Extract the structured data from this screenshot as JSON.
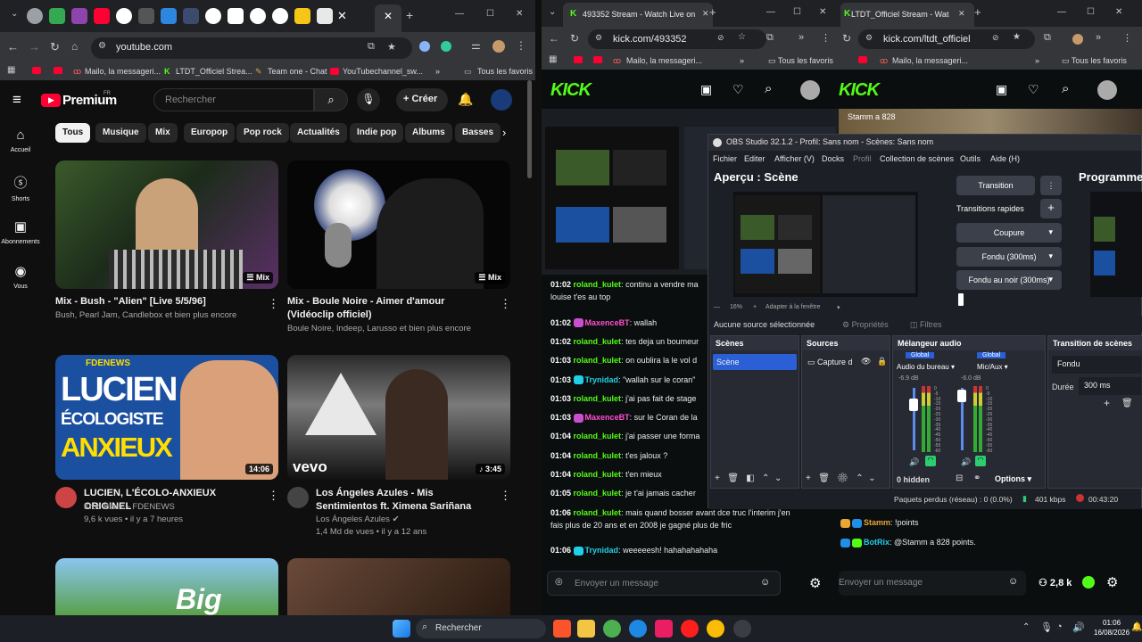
{
  "youtube": {
    "tabs": {
      "new_tab": "+",
      "minimize": "—",
      "maximize": "☐",
      "close": "✕"
    },
    "url": "youtube.com",
    "bookmarks": [
      "Mailo, la messageri...",
      "LTDT_Officiel Strea...",
      "Team one - Chat",
      "YouTubechannel_sw...",
      "Tous les favoris"
    ],
    "logo": "Premium",
    "logo_region": "FR",
    "search_placeholder": "Rechercher",
    "create_label": "Créer",
    "nav": [
      {
        "label": "Accueil",
        "icon": "home-icon"
      },
      {
        "label": "Shorts",
        "icon": "shorts-icon"
      },
      {
        "label": "Abonnements",
        "icon": "subscriptions-icon"
      },
      {
        "label": "Vous",
        "icon": "user-icon"
      }
    ],
    "chips": [
      "Tous",
      "Musique",
      "Mix",
      "Europop",
      "Pop rock",
      "Actualités",
      "Indie pop",
      "Albums",
      "Basses"
    ],
    "videos": [
      {
        "title": "Mix - Bush - \"Alien\" [Live 5/5/96]",
        "meta1": "Bush, Pearl Jam, Candlebox et bien plus encore",
        "meta2": "",
        "duration": "Mix"
      },
      {
        "title": "Mix - Boule Noire - Aimer d'amour (Vidéoclip officiel)",
        "meta1": "Boule Noire, Indeep, Larusso et bien plus encore",
        "meta2": "",
        "duration": "Mix"
      },
      {
        "title": "LUCIEN, L'ÉCOLO-ANXIEUX ORIGINEL",
        "meta1": "Kroc Blanc - FDENEWS",
        "meta2": "9,6 k vues • il y a 7 heures",
        "duration": "14:06"
      },
      {
        "title": "Los Ángeles Azules - Mis Sentimientos ft. Ximena Sariñana",
        "meta1": "Los Ángeles Azules",
        "meta2": "1,4 Md de vues • il y a 12 ans",
        "duration": "3:45"
      }
    ],
    "thumb_text": {
      "fdenews": "FDENEWS",
      "lucien1": "LUCIEN",
      "lucien2": "ÉCOLOGISTE",
      "lucien3": "ANXIEUX",
      "vevo": "vevo",
      "big": "Big"
    }
  },
  "kick1": {
    "tab_title": "493352 Stream - Watch Live on",
    "url": "kick.com/493352",
    "bookmarks": [
      "Mailo, la messageri...",
      "Tous les favoris"
    ],
    "logo": "KICK",
    "chat": [
      {
        "time": "01:02",
        "user": "roland_kulet",
        "color": "u",
        "msg": ": continu a vendre ma"
      },
      {
        "time": "",
        "user": "",
        "color": "u",
        "msg": "louise t'es au top"
      },
      {
        "time": "01:02",
        "user": "MaxenceBT",
        "color": "p",
        "msg": ": wallah"
      },
      {
        "time": "01:02",
        "user": "roland_kulet",
        "color": "u",
        "msg": ": tes deja un boumeur"
      },
      {
        "time": "01:03",
        "user": "roland_kulet",
        "color": "u",
        "msg": ": on oublira la le vol d"
      },
      {
        "time": "01:03",
        "user": "Trynidad",
        "color": "c",
        "msg": ": \"wallah sur le coran\""
      },
      {
        "time": "01:03",
        "user": "roland_kulet",
        "color": "u",
        "msg": ": j'ai pas fait de stage"
      },
      {
        "time": "01:03",
        "user": "MaxenceBT",
        "color": "p",
        "msg": ": sur le Coran de la"
      },
      {
        "time": "01:04",
        "user": "roland_kulet",
        "color": "u",
        "msg": ": j'ai passer une forma"
      },
      {
        "time": "01:04",
        "user": "roland_kulet",
        "color": "u",
        "msg": ": t'es jaloux ?"
      },
      {
        "time": "01:04",
        "user": "roland_kulet",
        "color": "u",
        "msg": ": t'en mieux"
      },
      {
        "time": "01:05",
        "user": "roland_kulet",
        "color": "u",
        "msg": ": je t'ai jamais cacher"
      },
      {
        "time": "01:06",
        "user": "roland_kulet",
        "color": "u",
        "msg": ": mais quand bosser avant dce truc l'interim j'en"
      },
      {
        "time": "",
        "user": "",
        "color": "u",
        "msg": "fais plus de 20 ans et en 2008 je gagné plus de fric"
      },
      {
        "time": "01:06",
        "user": "Trynidad",
        "color": "c",
        "msg": ": weeeeesh! hahahahahaha"
      }
    ],
    "message_placeholder": "Envoyer un message"
  },
  "kick2": {
    "tab_title": "LTDT_Officiel Stream - Watch Li",
    "url": "kick.com/ltdt_officiel",
    "bookmarks": [
      "Mailo, la messageri...",
      "Tous les favoris"
    ],
    "logo": "KICK",
    "overlay_text": "Stamm a 828",
    "chat": [
      {
        "user": "Stamm",
        "msg": ": !points",
        "color": "#e8a634"
      },
      {
        "user": "BotRix",
        "msg": ": @Stamm a 828 points.",
        "color": "#1fd0e8"
      }
    ],
    "message_placeholder": "Envoyer un message",
    "viewers": "2,8 k"
  },
  "obs": {
    "title": "OBS Studio 32.1.2 - Profil: Sans nom - Scènes: Sans nom",
    "menu": [
      "Fichier",
      "Editer",
      "Afficher (V)",
      "Docks",
      "Profil",
      "Collection de scènes",
      "Outils",
      "Aide (H)"
    ],
    "preview_label": "Aperçu : Scène",
    "program_label": "Programme",
    "transition_btn": "Transition",
    "quick_transitions": "Transitions rapides",
    "cut": "Coupure",
    "fade": "Fondu (300ms)",
    "fade_black": "Fondu au noir (300ms)",
    "zoom": "16%",
    "fit": "Adapter à la fenêtre",
    "no_source": "Aucune source sélectionnée",
    "properties": "Propriétés",
    "filters": "Filtres",
    "scenes_header": "Scènes",
    "scene_item": "Scène",
    "sources_header": "Sources",
    "source_item": "Capture d",
    "mixer_header": "Mélangeur audio",
    "mixer_global": "Global",
    "mixer_ch1": "Audio du bureau",
    "mixer_ch2": "Mic/Aux",
    "mixer_db1": "-6.9 dB",
    "mixer_db2": "-6.0 dB",
    "hidden": "0 hidden",
    "options": "Options",
    "transition_header": "Transition de scènes",
    "transition_value": "Fondu",
    "duration_label": "Durée",
    "duration_value": "300 ms",
    "status_dropped": "Paquets perdus (réseau) : 0 (0.0%)",
    "status_kbps": "401 kbps",
    "status_time": "00:43:20",
    "scale_marks": [
      "0",
      "-5",
      "-10",
      "-15",
      "-20",
      "-25",
      "-30",
      "-35",
      "-40",
      "-45",
      "-50",
      "-55",
      "-60"
    ]
  },
  "taskbar": {
    "search": "Rechercher",
    "time": "01:06",
    "date": "16/08/2026"
  }
}
